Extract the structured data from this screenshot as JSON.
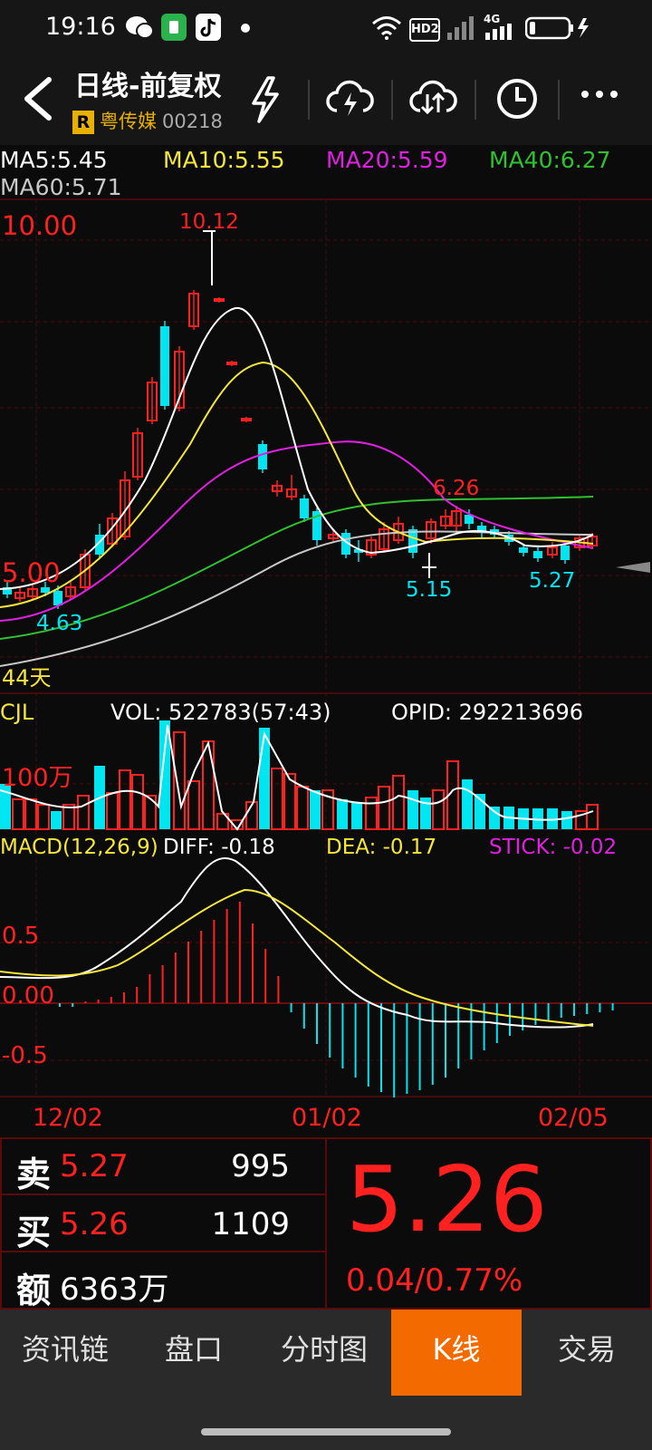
{
  "status_bar": {
    "time": "19:16",
    "icons": [
      "wechat-icon",
      "app-green-icon",
      "tiktok-icon",
      "dot-icon",
      "wifi-icon",
      "hd-icon",
      "signal-icon",
      "4g-signal-icon",
      "battery-icon"
    ],
    "hd_label": "HD2",
    "net_label": "4G"
  },
  "header": {
    "title": "日线-前复权",
    "badge": "R",
    "stock_name": "粤传媒",
    "stock_code": "00218",
    "icons": [
      "back-icon",
      "lightning-icon",
      "cloud-lightning-icon",
      "cloud-sync-icon",
      "clock-icon",
      "more-icon"
    ]
  },
  "ma_legend": {
    "ma5": "MA5:5.45",
    "ma10": "MA10:5.55",
    "ma20": "MA20:5.59",
    "ma40": "MA40:6.27",
    "ma60": "MA60:5.71"
  },
  "main_chart": {
    "ylabel_top": "10.00",
    "ylabel_mid": "5.00",
    "days_label": "44天",
    "high_label": "10.12",
    "low_label_1": "4.63",
    "peak_label_2": "6.26",
    "low_label_2": "5.15",
    "low_label_3": "5.27"
  },
  "volume": {
    "label": "CJL",
    "vol": "VOL: 522783(57:43)",
    "opid": "OPID: 292213696",
    "ytick": "100万"
  },
  "macd": {
    "label": "MACD(12,26,9)",
    "diff": "DIFF: -0.18",
    "dea": "DEA: -0.17",
    "stick": "STICK: -0.02",
    "y_pos": "0.5",
    "y_zero": "0.00",
    "y_neg": "-0.5"
  },
  "x_axis": [
    "12/02",
    "01/02",
    "02/05"
  ],
  "quote": {
    "sell_label": "卖",
    "sell_price": "5.27",
    "sell_qty": "995",
    "buy_label": "买",
    "buy_price": "5.26",
    "buy_qty": "1109",
    "amount_label": "额",
    "amount": "6363万",
    "last_price": "5.26",
    "change": "0.04/0.77%"
  },
  "tabs": [
    {
      "label": "资讯链",
      "active": false
    },
    {
      "label": "盘口",
      "active": false
    },
    {
      "label": "分时图",
      "active": false
    },
    {
      "label": "K线",
      "active": true
    },
    {
      "label": "交易",
      "active": false
    }
  ],
  "colors": {
    "up": "#ff2020",
    "down": "#00e5f0",
    "ma5": "#ffffff",
    "ma10": "#f5e63c",
    "ma20": "#e020e0",
    "ma40": "#30c030",
    "ma60": "#c8c8c8",
    "accent": "#f26a00",
    "grid": "#5a0a0a"
  }
}
